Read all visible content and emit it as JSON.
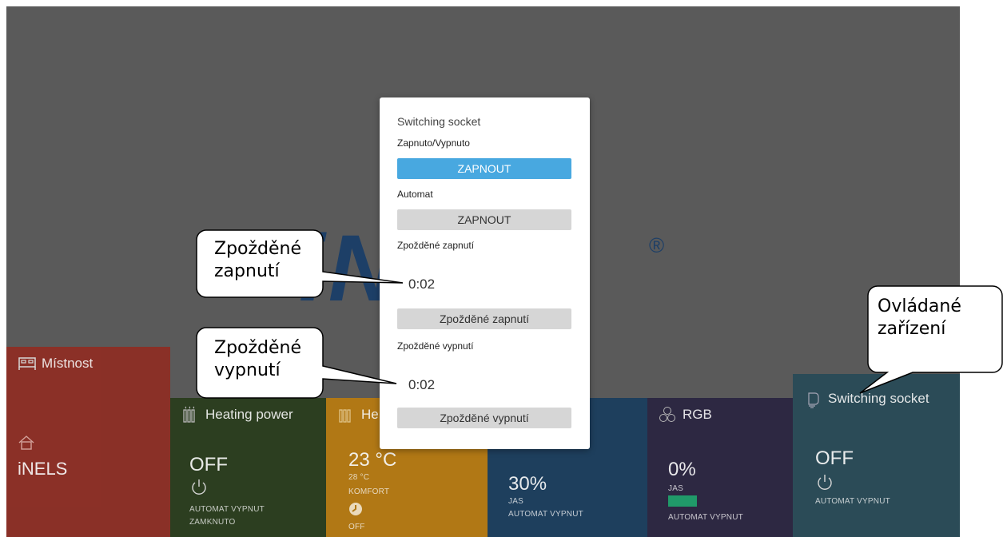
{
  "background": {
    "logo_text": "iNELS",
    "logo_reg": "®",
    "accent": "#1d3f67"
  },
  "tiles": {
    "room": {
      "label": "Místnost",
      "name": "iNELS",
      "color": "#8d2f25"
    },
    "heating_power": {
      "label": "Heating power",
      "state": "OFF",
      "line1": "AUTOMAT VYPNUT",
      "line2": "ZAMKNUTO",
      "color": "#2b3d1e"
    },
    "heating": {
      "label": "He",
      "temp": "23 °C",
      "set_temp": "28 °C",
      "mode": "KOMFORT",
      "state": "OFF",
      "color": "#b57a13"
    },
    "light": {
      "value": "30%",
      "line1": "JAS",
      "line2": "AUTOMAT VYPNUT",
      "color": "#1c3e5e"
    },
    "rgb": {
      "label": "RGB",
      "value": "0%",
      "line1": "JAS",
      "line2": "AUTOMAT VYPNUT",
      "swatch": "#1e9d6a",
      "color": "#2c2642"
    },
    "socket": {
      "label": "Switching socket",
      "state": "OFF",
      "line1": "AUTOMAT VYPNUT",
      "color": "#2a4b57"
    }
  },
  "dialog": {
    "title": "Switching socket",
    "onoff_label": "Zapnuto/Vypnuto",
    "onoff_button": "ZAPNOUT",
    "auto_label": "Automat",
    "auto_button": "ZAPNOUT",
    "delay_on_label": "Zpožděné zapnutí",
    "delay_on_time": "0:02",
    "delay_on_button": "Zpožděné zapnutí",
    "delay_off_label": "Zpožděné vypnutí",
    "delay_off_time": "0:02",
    "delay_off_button": "Zpožděné vypnutí"
  },
  "callouts": {
    "delay_on": {
      "line1": "Zpožděné",
      "line2": "zapnutí"
    },
    "delay_off": {
      "line1": "Zpožděné",
      "line2": "vypnutí"
    },
    "device": {
      "line1": "Ovládané",
      "line2": "zařízení"
    }
  }
}
